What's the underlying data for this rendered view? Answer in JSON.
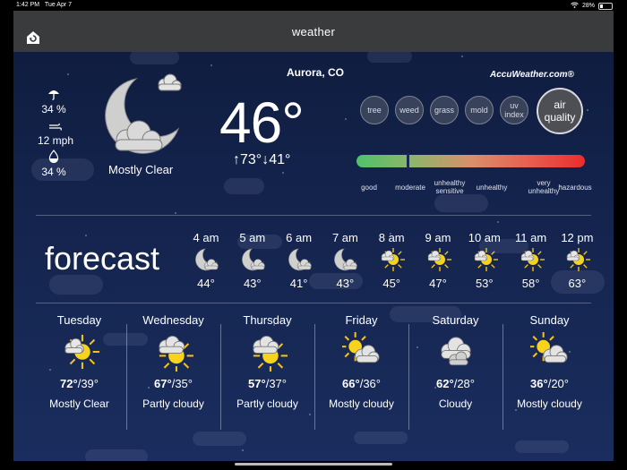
{
  "status_bar": {
    "time": "1:42 PM",
    "date": "Tue Apr 7",
    "battery": "28%",
    "battery_level": 0.28
  },
  "header": {
    "title": "weather",
    "home_icon": "home-icon"
  },
  "current": {
    "location": "Aurora, CO",
    "temperature": "46°",
    "high": "73°",
    "low": "41°",
    "condition": "Mostly Clear",
    "precip": "34 %",
    "wind": "12 mph",
    "humidity": "34 %"
  },
  "provider": "AccuWeather.com®",
  "air_quality": {
    "buttons": [
      "tree",
      "weed",
      "grass",
      "mold",
      "uv index",
      "air quality"
    ],
    "active": "air quality",
    "scale": [
      "good",
      "moderate",
      "unhealthy sensitive",
      "unhealthy",
      "very unhealthy",
      "hazardous"
    ],
    "level": 0.22,
    "colors": [
      "#4fc26a",
      "#d8906b",
      "#ea2d2d"
    ]
  },
  "forecast": {
    "title": "forecast",
    "hours": [
      {
        "time": "4 am",
        "temp": "44°",
        "icon": "moon-cloud-icon"
      },
      {
        "time": "5 am",
        "temp": "43°",
        "icon": "moon-cloud-icon"
      },
      {
        "time": "6 am",
        "temp": "41°",
        "icon": "moon-cloud-icon"
      },
      {
        "time": "7 am",
        "temp": "43°",
        "icon": "moon-cloud-icon"
      },
      {
        "time": "8 am",
        "temp": "45°",
        "icon": "sun-cloud-icon"
      },
      {
        "time": "9 am",
        "temp": "47°",
        "icon": "sun-cloud-icon"
      },
      {
        "time": "10 am",
        "temp": "53°",
        "icon": "sun-cloud-icon"
      },
      {
        "time": "11 am",
        "temp": "58°",
        "icon": "sun-cloud-icon"
      },
      {
        "time": "12 pm",
        "temp": "63°",
        "icon": "sun-cloud-icon"
      }
    ],
    "days": [
      {
        "name": "Tuesday",
        "high": "72°",
        "low": "39°",
        "condition": "Mostly Clear",
        "icon": "sun-cloud-icon"
      },
      {
        "name": "Wednesday",
        "high": "67°",
        "low": "35°",
        "condition": "Partly cloudy",
        "icon": "cloud-sun-icon"
      },
      {
        "name": "Thursday",
        "high": "57°",
        "low": "37°",
        "condition": "Partly cloudy",
        "icon": "cloud-sun-icon"
      },
      {
        "name": "Friday",
        "high": "66°",
        "low": "36°",
        "condition": "Mostly cloudy",
        "icon": "sun-behind-cloud-icon"
      },
      {
        "name": "Saturday",
        "high": "62°",
        "low": "28°",
        "condition": "Cloudy",
        "icon": "cloud-icon"
      },
      {
        "name": "Sunday",
        "high": "36°",
        "low": "20°",
        "condition": "Mostly cloudy",
        "icon": "sun-behind-cloud-icon"
      }
    ]
  }
}
